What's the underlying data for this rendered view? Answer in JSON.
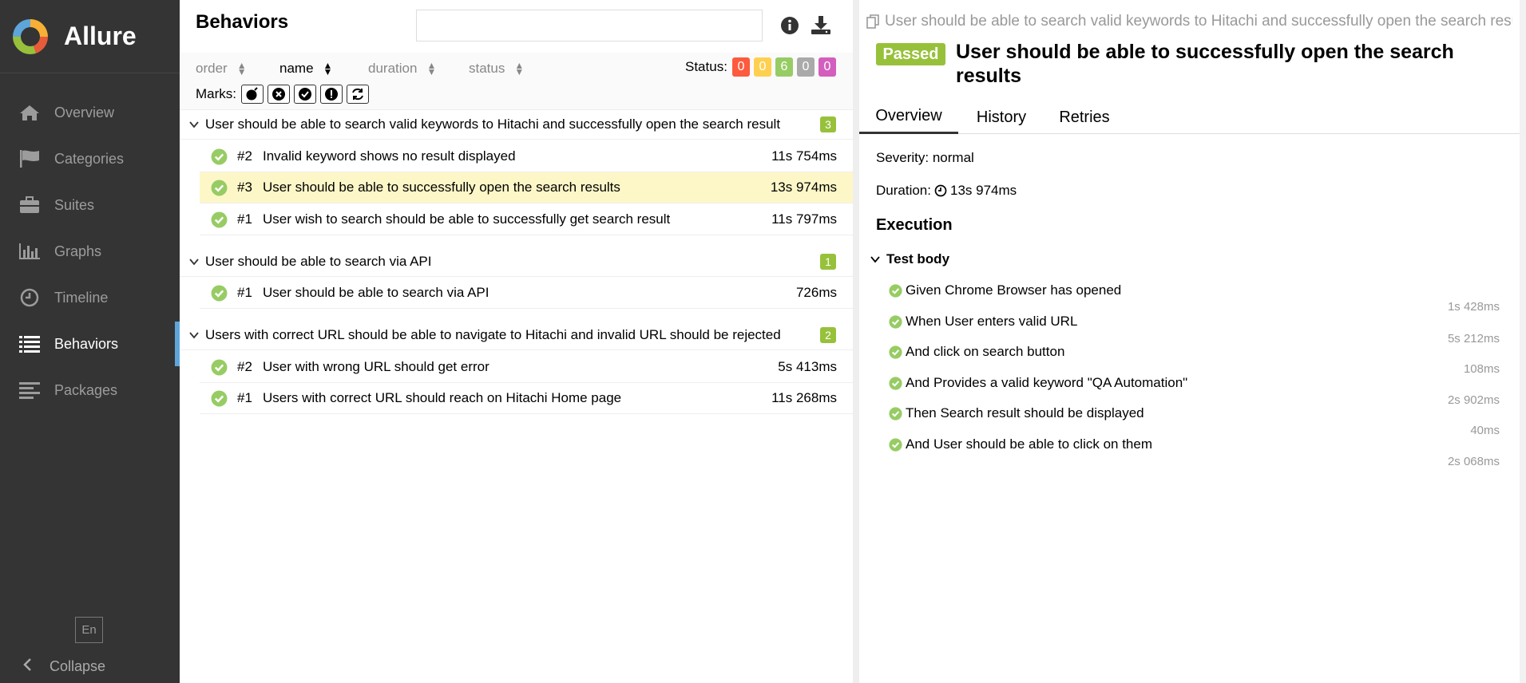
{
  "app": {
    "brand": "Allure"
  },
  "sidebar": {
    "items": [
      {
        "label": "Overview",
        "icon": "home-icon"
      },
      {
        "label": "Categories",
        "icon": "flag-icon"
      },
      {
        "label": "Suites",
        "icon": "briefcase-icon"
      },
      {
        "label": "Graphs",
        "icon": "bar-chart-icon"
      },
      {
        "label": "Timeline",
        "icon": "clock-icon"
      },
      {
        "label": "Behaviors",
        "icon": "list-icon",
        "active": true
      },
      {
        "label": "Packages",
        "icon": "align-left-icon"
      }
    ],
    "language": "En",
    "collapse_label": "Collapse"
  },
  "behaviors": {
    "title": "Behaviors",
    "search": {
      "value": "",
      "placeholder": ""
    },
    "sorters": {
      "order": "order",
      "name": "name",
      "duration": "duration",
      "status": "status"
    },
    "status_label": "Status:",
    "status_counts": {
      "failed": "0",
      "broken": "0",
      "passed": "6",
      "skipped": "0",
      "unknown": "0"
    },
    "status_colors": {
      "failed": "#fd5a3e",
      "broken": "#ffd050",
      "passed": "#97cc64",
      "skipped": "#aaaaaa",
      "unknown": "#d35ebe"
    },
    "marks_label": "Marks:",
    "groups": [
      {
        "name": "User should be able to search valid keywords to Hitachi and successfully open the search result",
        "count": "3",
        "rows": [
          {
            "order": "#2",
            "name": "Invalid keyword shows no result displayed",
            "duration": "11s 754ms"
          },
          {
            "order": "#3",
            "name": "User should be able to successfully open the search results",
            "duration": "13s 974ms"
          },
          {
            "order": "#1",
            "name": "User wish to search should be able to successfully get search result",
            "duration": "11s 797ms"
          }
        ]
      },
      {
        "name": "User should be able to search via API",
        "count": "1",
        "rows": [
          {
            "order": "#1",
            "name": "User should be able to search via API",
            "duration": "726ms"
          }
        ]
      },
      {
        "name": "Users with correct URL should be able to navigate to Hitachi and invalid URL should be rejected",
        "count": "2",
        "rows": [
          {
            "order": "#2",
            "name": "User with wrong URL should get error",
            "duration": "5s 413ms"
          },
          {
            "order": "#1",
            "name": "Users with correct URL should reach on Hitachi Home page",
            "duration": "11s 268ms"
          }
        ]
      }
    ]
  },
  "testresult": {
    "full_name": "User should be able to search valid keywords to Hitachi and successfully open the search results",
    "status": "Passed",
    "name": "User should be able to successfully open the search results",
    "tabs": [
      "Overview",
      "History",
      "Retries"
    ],
    "severity": "Severity: normal",
    "duration_label": "Duration:",
    "duration": "13s 974ms",
    "execution_title": "Execution",
    "test_body_title": "Test body",
    "steps": [
      {
        "name": "Given Chrome Browser has opened",
        "duration": "1s 428ms"
      },
      {
        "name": "When User enters valid URL",
        "duration": "5s 212ms"
      },
      {
        "name": "And click on search button",
        "duration": "108ms"
      },
      {
        "name": "And Provides a valid keyword \"QA Automation\"",
        "duration": "2s 902ms"
      },
      {
        "name": "Then Search result should be displayed",
        "duration": "40ms"
      },
      {
        "name": "And User should be able to click on them",
        "duration": "2s 068ms"
      }
    ]
  }
}
